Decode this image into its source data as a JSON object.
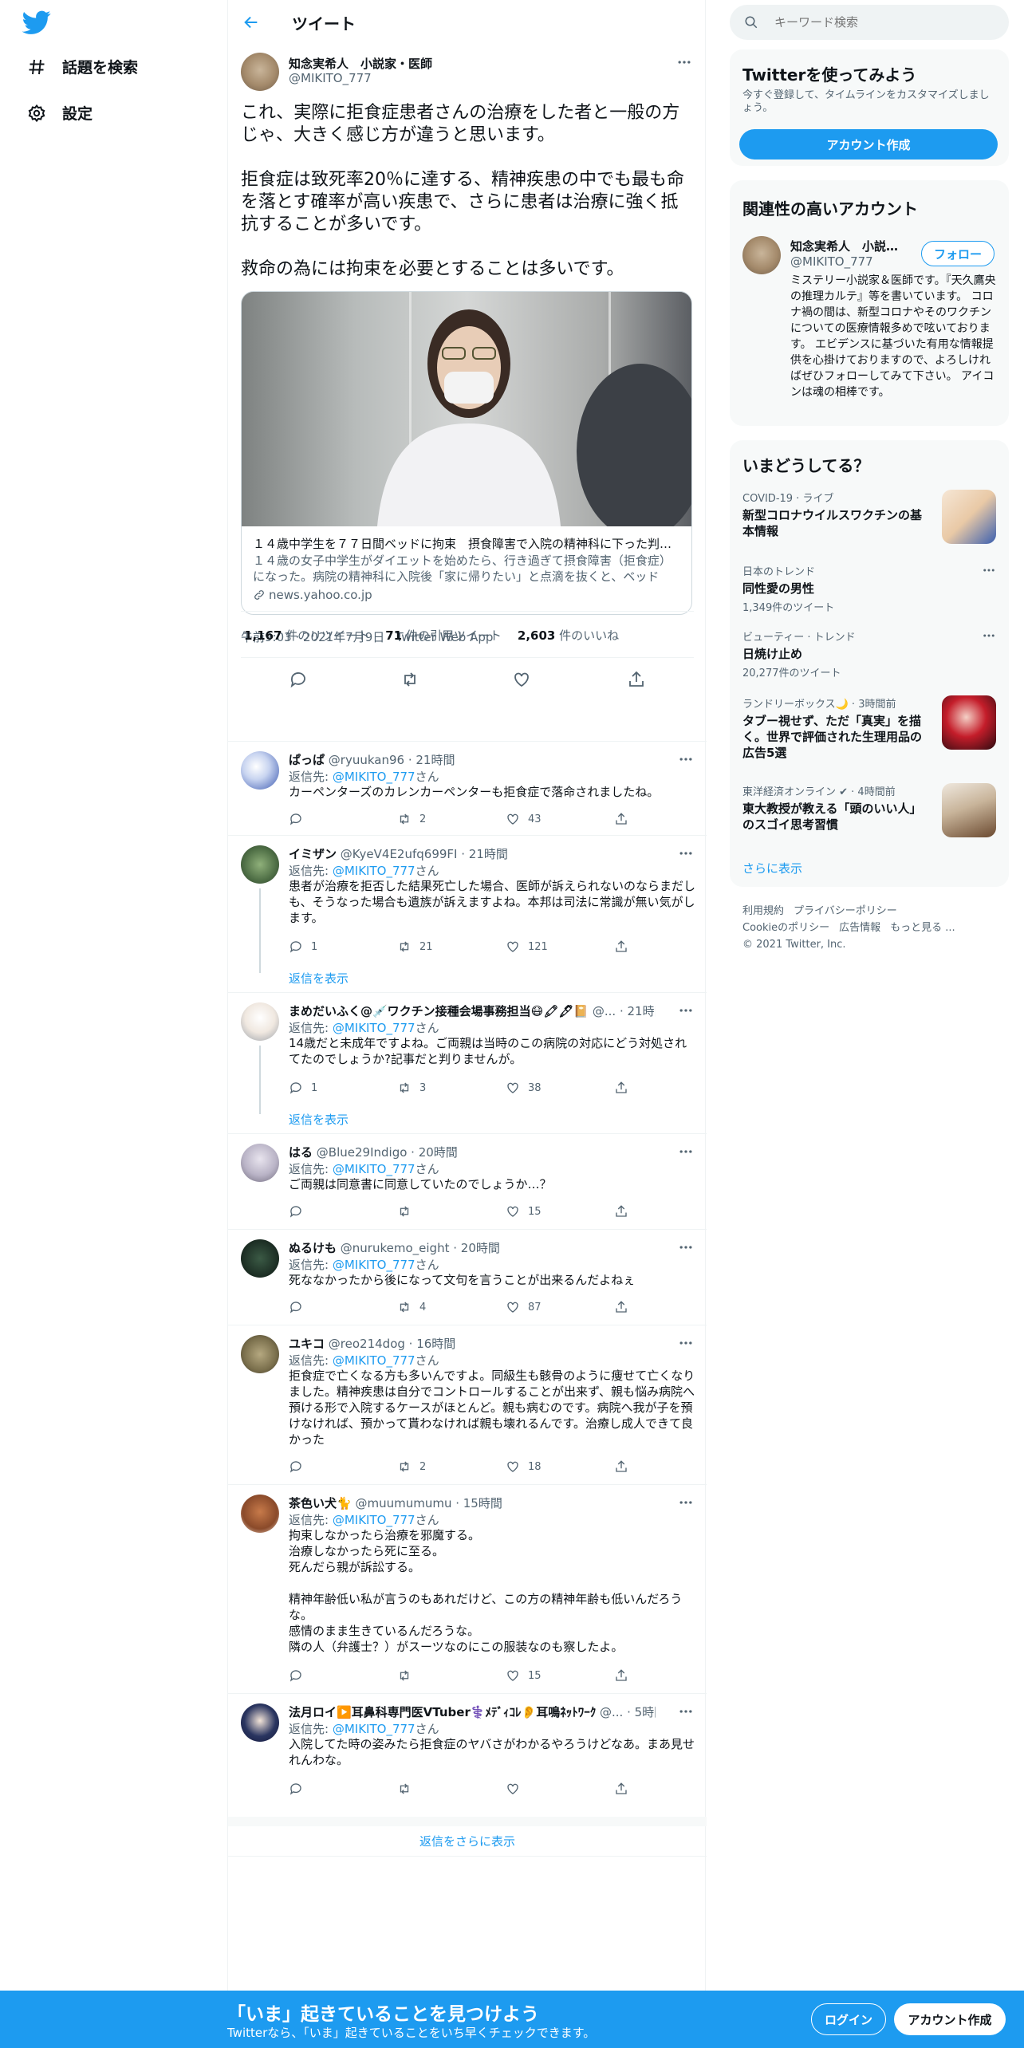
{
  "nav": {
    "explore_label": "話題を検索",
    "settings_label": "設定"
  },
  "header": {
    "title": "ツイート"
  },
  "tweet": {
    "author_name": "知念実希人　小説家・医師",
    "author_handle": "@MIKITO_777",
    "text": "これ、実際に拒食症患者さんの治療をした者と一般の方じゃ、大きく感じ方が違うと思います。\n\n拒食症は致死率20％に達する、精神疾患の中でも最も命を落とす確率が高い疾患で、さらに患者は治療に強く抵抗することが多いです。\n\n救命の為には拘束を必要とすることは多いです。",
    "card": {
      "title": "１４歳中学生を７７日間ベッドに拘束　摂食障害で入院の精神科に下った判決...",
      "description": "１４歳の女子中学生がダイエットを始めたら、行き過ぎて摂食障害（拒食症）になった。病院の精神科に入院後「家に帰りたい」と点滴を抜くと、ベッドに...",
      "domain": "news.yahoo.co.jp"
    },
    "timestamp": "午前9:03 · 2021年7月9日 · Twitter Web App",
    "retweets": "1,167",
    "retweets_label": "件のリツイート",
    "quotes": "71",
    "quotes_label": "件の引用ツイート",
    "likes": "2,603",
    "likes_label": "件のいいね"
  },
  "replies": [
    {
      "name": "ぱっぱ",
      "handle": "@ryuukan96",
      "time": "21時間",
      "reply_to_label": "返信先:",
      "reply_to": "@MIKITO_777",
      "reply_to_suffix": "さん",
      "text": "カーペンターズのカレンカーペンターも拒食症で落命されましたね。",
      "replies": "",
      "retweets": "2",
      "likes": "43"
    },
    {
      "name": "イミザン",
      "handle": "@KyeV4E2ufq699FI",
      "time": "21時間",
      "reply_to_label": "返信先:",
      "reply_to": "@MIKITO_777",
      "reply_to_suffix": "さん",
      "text": "患者が治療を拒否した結果死亡した場合、医師が訴えられないのならまだしも、そうなった場合も遺族が訴えますよね。本邦は司法に常識が無い気がします。",
      "replies": "1",
      "retweets": "21",
      "likes": "121",
      "show_replies": "返信を表示"
    },
    {
      "name": "まめだいふく@💉ワクチン接種会場事務担当😷🖍🖋📔",
      "handle": "@...",
      "time": "21時間",
      "reply_to_label": "返信先:",
      "reply_to": "@MIKITO_777",
      "reply_to_suffix": "さん",
      "text": "14歳だと未成年ですよね。ご両親は当時のこの病院の対応にどう対処されてたのでしょうか?記事だと判りませんが。",
      "replies": "1",
      "retweets": "3",
      "likes": "38",
      "show_replies": "返信を表示"
    },
    {
      "name": "はる",
      "handle": "@Blue29Indigo",
      "time": "20時間",
      "reply_to_label": "返信先:",
      "reply_to": "@MIKITO_777",
      "reply_to_suffix": "さん",
      "text": "ご両親は同意書に同意していたのでしょうか…？",
      "replies": "",
      "retweets": "",
      "likes": "15"
    },
    {
      "name": "ぬるけも",
      "handle": "@nurukemo_eight",
      "time": "20時間",
      "reply_to_label": "返信先:",
      "reply_to": "@MIKITO_777",
      "reply_to_suffix": "さん",
      "text": "死ななかったから後になって文句を言うことが出来るんだよねぇ",
      "replies": "",
      "retweets": "4",
      "likes": "87"
    },
    {
      "name": "ユキコ",
      "handle": "@reo214dog",
      "time": "16時間",
      "reply_to_label": "返信先:",
      "reply_to": "@MIKITO_777",
      "reply_to_suffix": "さん",
      "text": "拒食症で亡くなる方も多いんですよ。同級生も骸骨のように痩せて亡くなりました。精神疾患は自分でコントロールすることが出来ず、親も悩み病院へ預ける形で入院するケースがほとんど。親も病むのです。病院へ我が子を預けなければ、預かって貰わなければ親も壊れるんです。治療し成人できて良かった",
      "replies": "",
      "retweets": "2",
      "likes": "18"
    },
    {
      "name": "茶色い犬🐈",
      "handle": "@muumumumu",
      "time": "15時間",
      "reply_to_label": "返信先:",
      "reply_to": "@MIKITO_777",
      "reply_to_suffix": "さん",
      "text": "拘束しなかったら治療を邪魔する。\n治療しなかったら死に至る。\n死んだら親が訴訟する。\n\n精神年齢低い私が言うのもあれだけど、この方の精神年齢も低いんだろうな。\n感情のまま生きているんだろうな。\n隣の人（弁護士？）がスーツなのにこの服装なのも察したよ。",
      "replies": "",
      "retweets": "",
      "likes": "15"
    },
    {
      "name": "法月ロイ▶️耳鼻科専門医VTuber⚕️ﾒﾃﾞｨｺﾚ👂耳鳴ﾈｯﾄﾜｰｸ",
      "handle": "@...",
      "time": "5時間",
      "reply_to_label": "返信先:",
      "reply_to": "@MIKITO_777",
      "reply_to_suffix": "さん",
      "text": "入院してた時の姿みたら拒食症のヤバさがわかるやろうけどなあ。まあ見せれんわな。",
      "replies": "",
      "retweets": "",
      "likes": ""
    }
  ],
  "more_replies_label": "返信をさらに表示",
  "right": {
    "search_placeholder": "キーワード検索",
    "signup_panel": {
      "title": "Twitterを使ってみよう",
      "subtitle": "今すぐ登録して、タイムラインをカスタマイズしましょう。",
      "button": "アカウント作成"
    },
    "related_panel": {
      "title": "関連性の高いアカウント",
      "name": "知念実希人　小説家...",
      "handle": "@MIKITO_777",
      "follow": "フォロー",
      "bio": "ミステリー小説家＆医師です。『天久鷹央の推理カルテ』等を書いています。 コロナ禍の間は、新型コロナやそのワクチンについての医療情報多めで呟いております。 エビデンスに基づいた有用な情報提供を心掛けておりますので、よろしければぜひフォローしてみて下さい。 アイコンは魂の相棒です。"
    },
    "trends_panel": {
      "title": "いまどうしてる？",
      "items": [
        {
          "context": "COVID-19 · ライブ",
          "title": "新型コロナウイルスワクチンの基本情報",
          "count": ""
        },
        {
          "context": "日本のトレンド",
          "title": "同性愛の男性",
          "count": "1,349件のツイート"
        },
        {
          "context": "ビューティー · トレンド",
          "title": "日焼け止め",
          "count": "20,277件のツイート"
        },
        {
          "context": "ランドリーボックス🌙 · 3時間前",
          "title": "タブー視せず、ただ「真実」を描く。世界で評価された生理用品の広告5選",
          "count": ""
        },
        {
          "context": "東洋経済オンライン ✔ · 4時間前",
          "title": "東大教授が教える「頭のいい人」のスゴイ思考習慣",
          "count": ""
        }
      ],
      "show_more": "さらに表示"
    },
    "footer": {
      "links": [
        "利用規約",
        "プライバシーポリシー",
        "Cookieのポリシー",
        "広告情報",
        "もっと見る ..."
      ],
      "copyright": "© 2021 Twitter, Inc."
    }
  },
  "bottom_bar": {
    "title": "「いま」起きていることを見つけよう",
    "subtitle": "Twitterなら、「いま」起きていることをいち早くチェックできます。",
    "login": "ログイン",
    "signup": "アカウント作成"
  },
  "colors": {
    "accent": "#1d9bf0",
    "text": "#0f1419",
    "secondary": "#536471"
  }
}
